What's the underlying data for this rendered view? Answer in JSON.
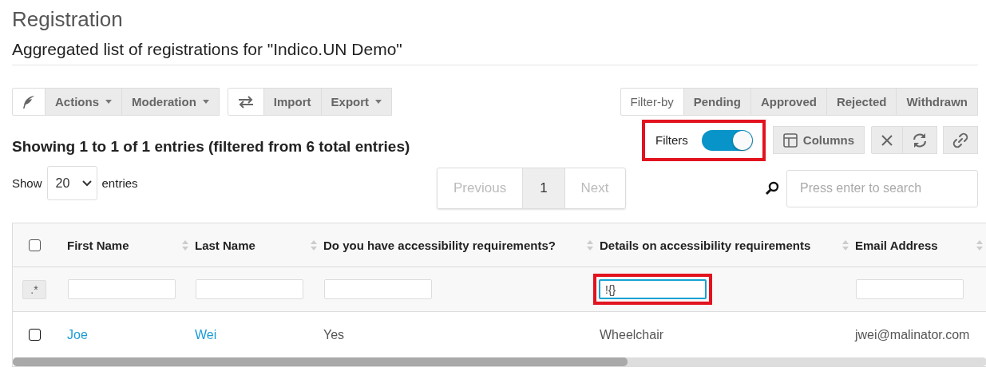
{
  "page": {
    "title": "Registration",
    "subtitle": "Aggregated list of registrations for \"Indico.UN Demo\""
  },
  "toolbar": {
    "group_1": [
      {
        "kind": "feather"
      },
      {
        "kind": "menu",
        "label": "Actions"
      },
      {
        "kind": "menu",
        "label": "Moderation"
      }
    ],
    "group_2": [
      {
        "kind": "swap"
      },
      {
        "kind": "plain",
        "label": "Import"
      },
      {
        "kind": "menu",
        "label": "Export"
      }
    ],
    "filter_by": {
      "label": "Filter-by",
      "options": [
        "Pending",
        "Approved",
        "Rejected",
        "Withdrawn"
      ]
    }
  },
  "summary": "Showing 1 to 1 of 1 entries (filtered from 6 total entries)",
  "filters_toggle": {
    "label": "Filters",
    "on": true,
    "highlighted": true
  },
  "columns_button": {
    "label": "Columns"
  },
  "length": {
    "before": "Show",
    "value": "20",
    "after": "entries"
  },
  "pagination": {
    "previous": "Previous",
    "pages": [
      {
        "label": "1",
        "selected": true
      }
    ],
    "next": "Next",
    "previous_disabled": true,
    "next_disabled": true
  },
  "search": {
    "placeholder": "Press enter to search"
  },
  "table": {
    "regex_button": ".*",
    "select_all_checked": false,
    "columns": [
      {
        "label": "First Name",
        "filter_highlighted": false,
        "filter_focused": false
      },
      {
        "label": "Last Name",
        "filter_highlighted": false,
        "filter_focused": false
      },
      {
        "label": "Do you have accessibility requirements?",
        "filter_highlighted": false,
        "filter_focused": false
      },
      {
        "label": "Details on accessibility requirements",
        "filter": "!{}",
        "filter_highlighted": true,
        "filter_focused": true
      },
      {
        "label": "Email Address",
        "filter_highlighted": false,
        "filter_focused": false
      }
    ],
    "rows": [
      {
        "checked": false,
        "cells": [
          {
            "text": "Joe",
            "link": true
          },
          {
            "text": "Wei",
            "link": true
          },
          {
            "text": "Yes",
            "link": false
          },
          {
            "text": "Wheelchair",
            "link": false
          },
          {
            "text": "jwei@malinator.com",
            "link": false
          }
        ]
      }
    ]
  }
}
